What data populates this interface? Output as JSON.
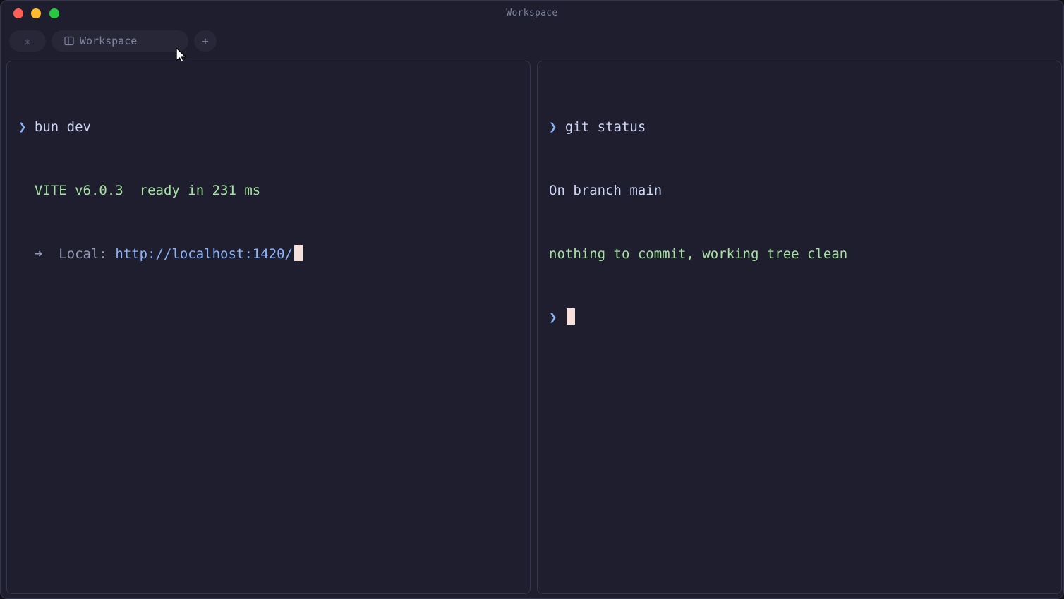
{
  "window": {
    "title": "Workspace"
  },
  "tabs": {
    "star": {
      "icon": "asterisk-icon",
      "glyph": "✳"
    },
    "workspace": {
      "icon": "split-panes-icon",
      "label": "Workspace"
    },
    "add": {
      "icon": "plus-icon",
      "glyph": "+"
    }
  },
  "panes": {
    "left": {
      "prompt_glyph": "❯",
      "command": "bun dev",
      "vite_label": "VITE v6.0.3",
      "ready_text": "ready in 231 ms",
      "arrow_glyph": "➜",
      "local_label": "Local:",
      "local_url": "http://localhost:1420/"
    },
    "right": {
      "prompt_glyph": "❯",
      "command": "git status",
      "branch_line": "On branch main",
      "status_line": "nothing to commit, working tree clean",
      "prompt2_glyph": "❯"
    }
  },
  "colors": {
    "background": "#1e1e2e",
    "prompt": "#89b4fa",
    "success": "#a6e3a1",
    "text": "#cdd6f4",
    "cursor": "#f5e0dc"
  }
}
